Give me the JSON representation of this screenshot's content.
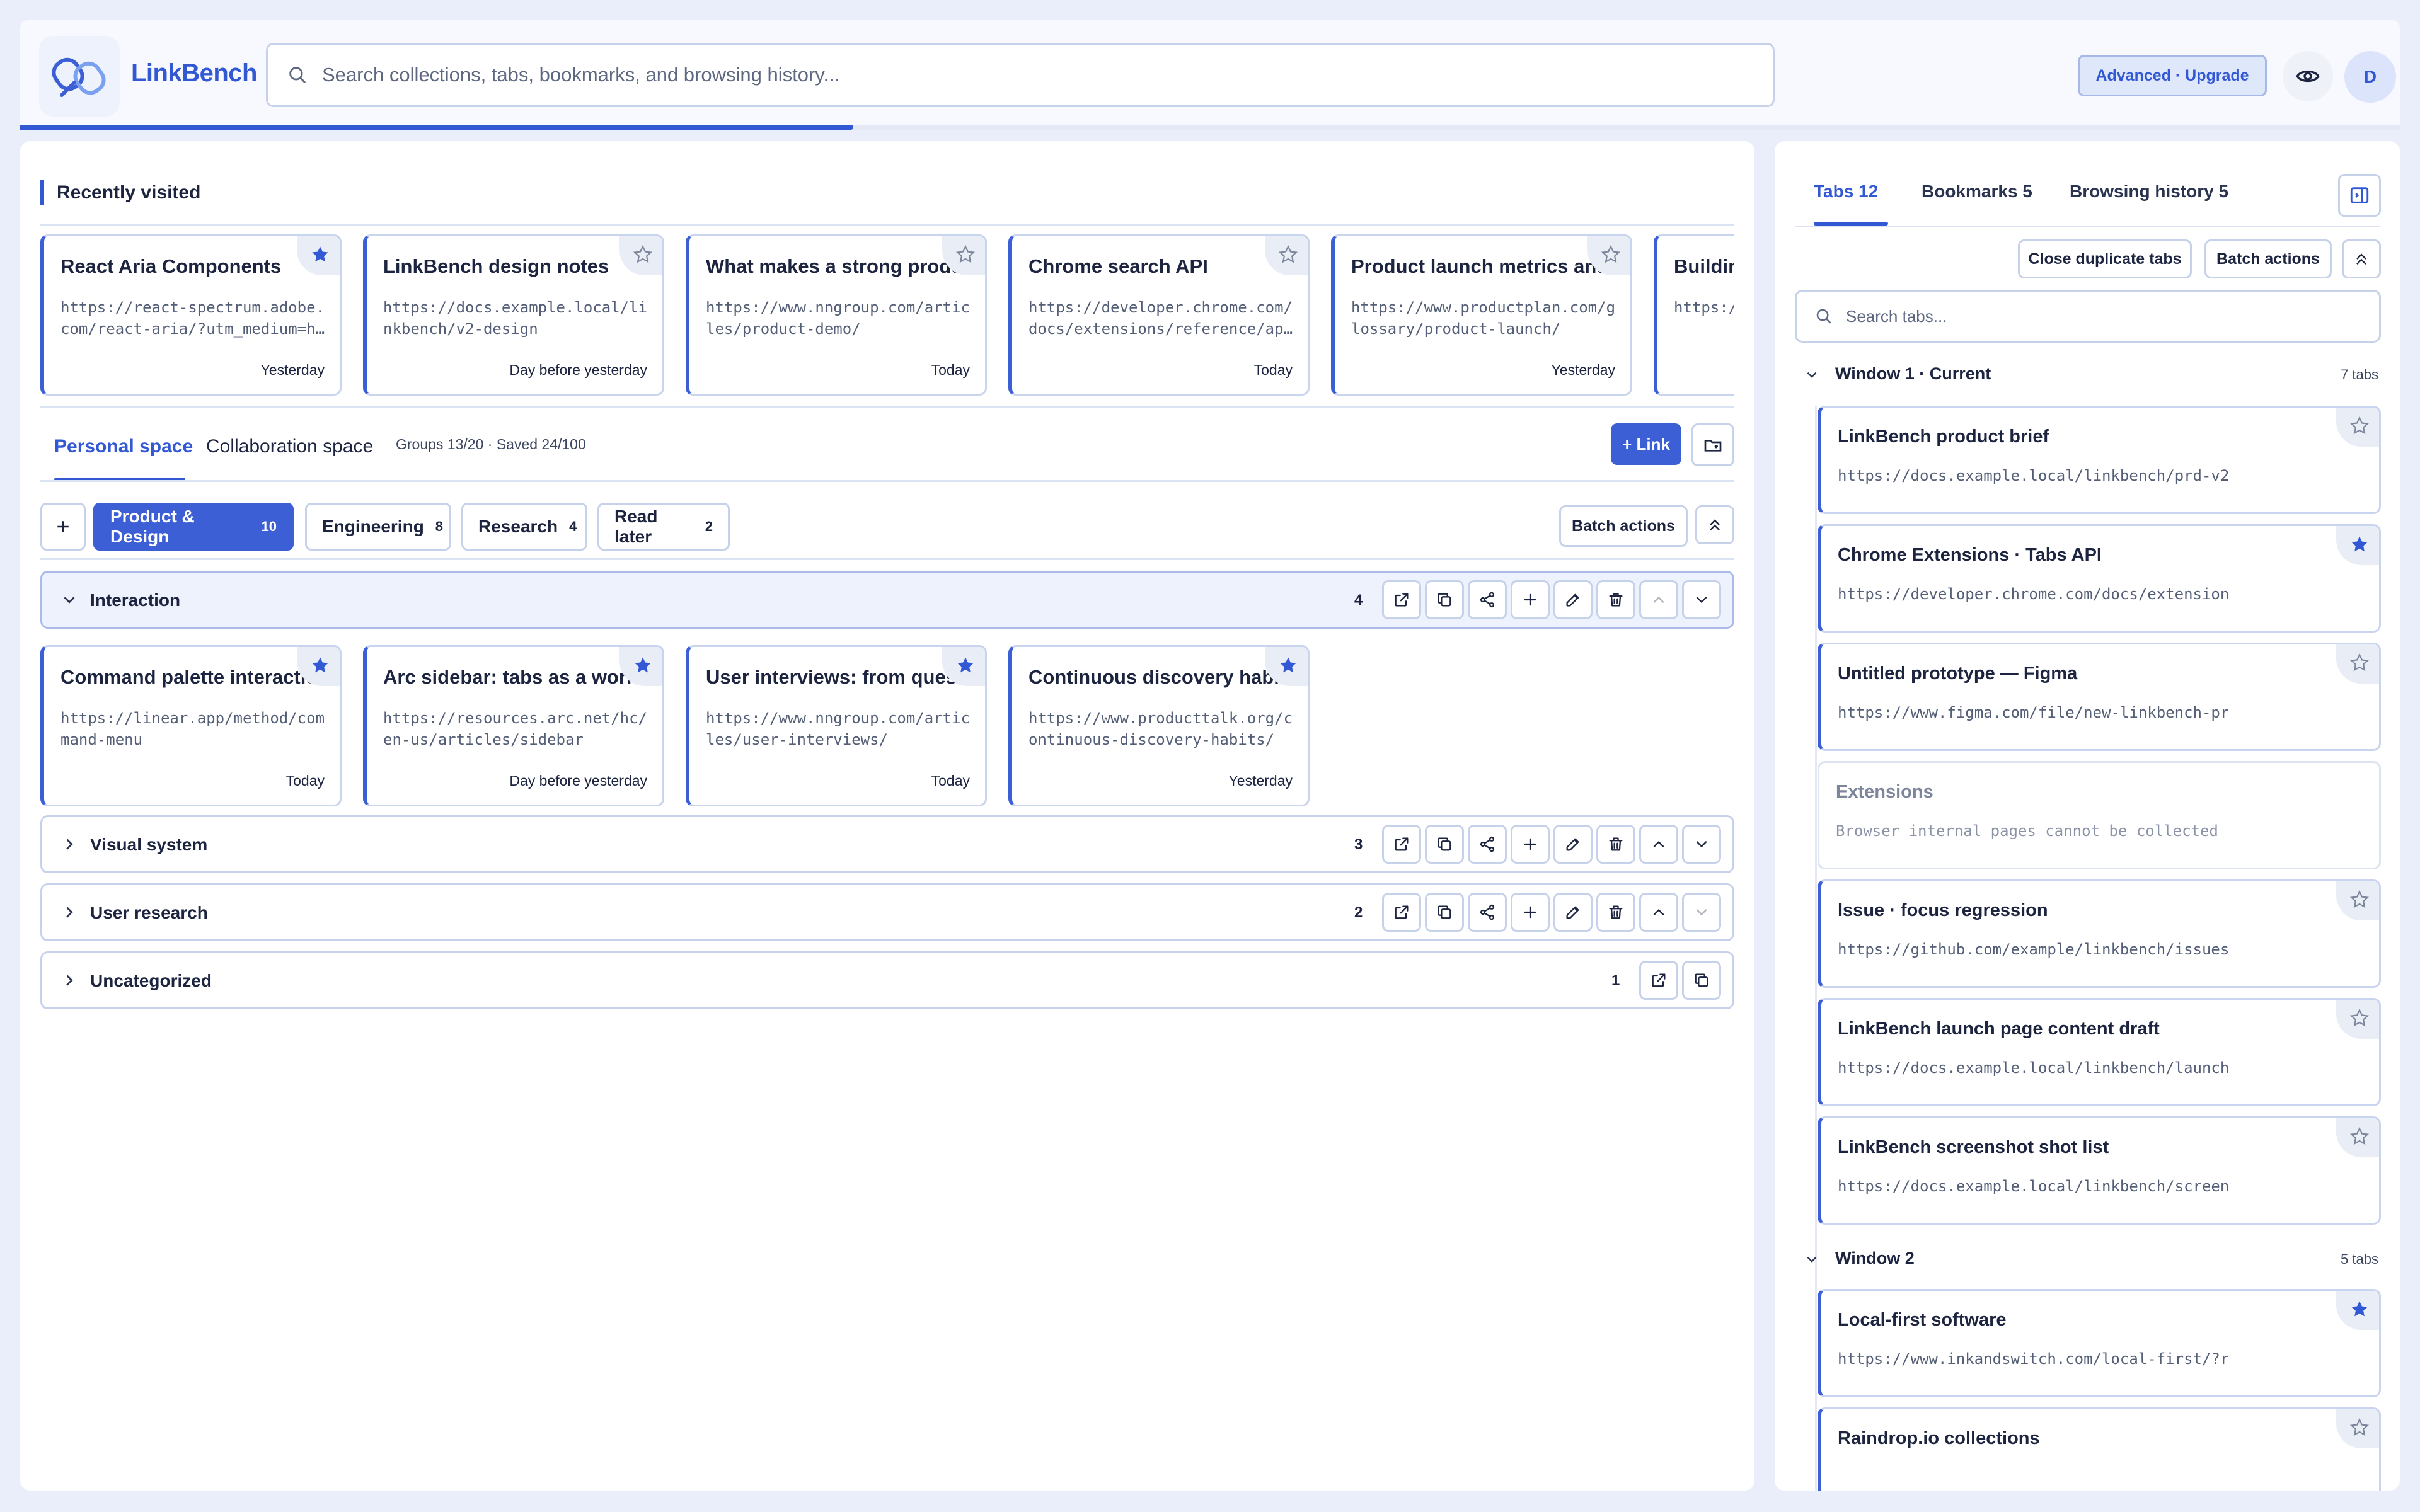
{
  "header": {
    "brand": "LinkBench",
    "search_placeholder": "Search collections, tabs, bookmarks, and browsing history...",
    "upgrade_label": "Advanced · Upgrade",
    "avatar_initial": "D",
    "progress": 0.35
  },
  "recent": {
    "title": "Recently visited",
    "cards": [
      {
        "title": "React Aria Components",
        "url": "https://react-spectrum.adobe.com/react-aria/?utm_medium=h…",
        "time": "Yesterday",
        "starred": true
      },
      {
        "title": "LinkBench design notes",
        "url": "https://docs.example.local/linkbench/v2-design",
        "time": "Day before yesterday",
        "starred": false
      },
      {
        "title": "What makes a strong product",
        "url": "https://www.nngroup.com/articles/product-demo/",
        "time": "Today",
        "starred": false
      },
      {
        "title": "Chrome search API",
        "url": "https://developer.chrome.com/docs/extensions/reference/ap…",
        "time": "Today",
        "starred": false
      },
      {
        "title": "Product launch metrics and re",
        "url": "https://www.productplan.com/glossary/product-launch/",
        "time": "Yesterday",
        "starred": false
      },
      {
        "title": "Buildin",
        "url": "https:/",
        "time": "",
        "starred": false
      }
    ]
  },
  "spaces": {
    "personal": "Personal space",
    "collab": "Collaboration space",
    "meta": "Groups 13/20 · Saved 24/100",
    "link_button": "+ Link"
  },
  "groups_bar": {
    "chips": [
      {
        "label": "Product & Design",
        "count": "10",
        "active": true
      },
      {
        "label": "Engineering",
        "count": "8",
        "active": false
      },
      {
        "label": "Research",
        "count": "4",
        "active": false
      },
      {
        "label": "Read later",
        "count": "2",
        "active": false
      }
    ],
    "batch_label": "Batch actions"
  },
  "groups": [
    {
      "name": "Interaction",
      "count": "4",
      "open": true
    },
    {
      "name": "Visual system",
      "count": "3",
      "open": false
    },
    {
      "name": "User research",
      "count": "2",
      "open": false
    },
    {
      "name": "Uncategorized",
      "count": "1",
      "open": false
    }
  ],
  "interaction_cards": [
    {
      "title": "Command palette interaction",
      "url": "https://linear.app/method/command-menu",
      "time": "Today",
      "starred": true
    },
    {
      "title": "Arc sidebar: tabs as a worksp",
      "url": "https://resources.arc.net/hc/en-us/articles/sidebar",
      "time": "Day before yesterday",
      "starred": true
    },
    {
      "title": "User interviews: from questio",
      "url": "https://www.nngroup.com/articles/user-interviews/",
      "time": "Today",
      "starred": true
    },
    {
      "title": "Continuous discovery habits",
      "url": "https://www.producttalk.org/continuous-discovery-habits/",
      "time": "Yesterday",
      "starred": true
    }
  ],
  "right": {
    "tabs": [
      {
        "label": "Tabs 12"
      },
      {
        "label": "Bookmarks 5"
      },
      {
        "label": "Browsing history 5"
      }
    ],
    "close_dupes": "Close duplicate tabs",
    "batch_label": "Batch actions",
    "search_placeholder": "Search tabs...",
    "window1": {
      "name": "Window 1 · Current",
      "count": "7 tabs"
    },
    "window2": {
      "name": "Window 2",
      "count": "5 tabs"
    },
    "w1_tabs": [
      {
        "title": "LinkBench product brief",
        "url": "https://docs.example.local/linkbench/prd-v2",
        "starred": false,
        "dim": false
      },
      {
        "title": "Chrome Extensions · Tabs API",
        "url": "https://developer.chrome.com/docs/extension",
        "starred": true,
        "dim": false
      },
      {
        "title": "Untitled prototype — Figma",
        "url": "https://www.figma.com/file/new-linkbench-pr",
        "starred": false,
        "dim": false
      },
      {
        "title": "Extensions",
        "url": "Browser internal pages cannot be collected",
        "starred": false,
        "dim": true
      },
      {
        "title": "Issue · focus regression",
        "url": "https://github.com/example/linkbench/issues",
        "starred": false,
        "dim": false
      },
      {
        "title": "LinkBench launch page content draft",
        "url": "https://docs.example.local/linkbench/launch",
        "starred": false,
        "dim": false
      },
      {
        "title": "LinkBench screenshot shot list",
        "url": "https://docs.example.local/linkbench/screen",
        "starred": false,
        "dim": false
      }
    ],
    "w2_tabs": [
      {
        "title": "Local-first software",
        "url": "https://www.inkandswitch.com/local-first/?r",
        "starred": true,
        "dim": false
      },
      {
        "title": "Raindrop.io collections",
        "url": "",
        "starred": false,
        "dim": false
      }
    ]
  },
  "colors": {
    "accent": "#3358d4",
    "background": "#e9eefa",
    "border": "#c6d1ea"
  }
}
